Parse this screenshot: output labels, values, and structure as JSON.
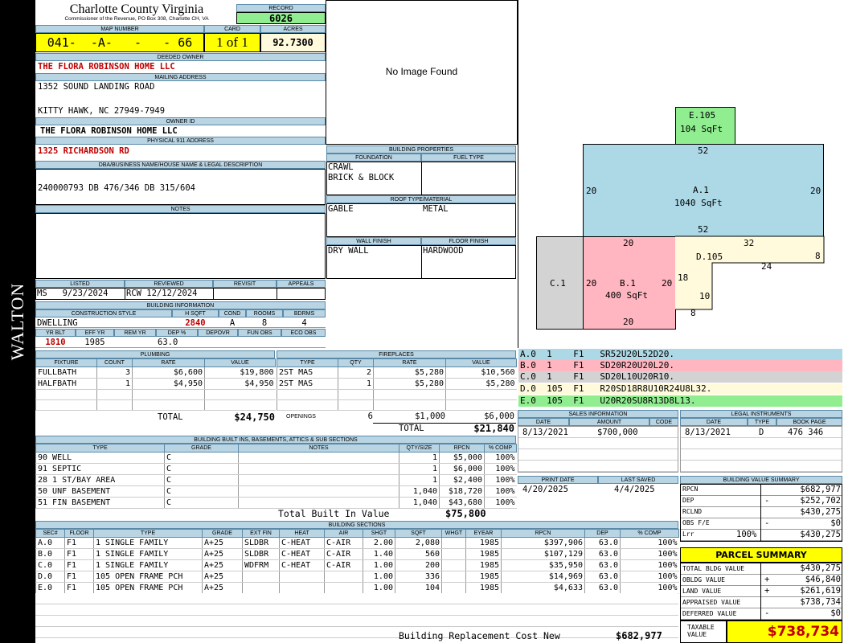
{
  "sidebar": {
    "name": "WALTON"
  },
  "header": {
    "county": "Charlotte County Virginia",
    "commissioner": "Commissioner of the Revenue, PO Box 308, Charlotte CH, VA",
    "record_label": "RECORD",
    "record": "6026",
    "map_label": "MAP NUMBER",
    "map_number": "041-  -A-   -   - 66",
    "card_label": "CARD",
    "card": "1 of 1",
    "acres_label": "ACRES",
    "acres": "92.7300"
  },
  "owner": {
    "deeded_label": "DEEDED OWNER",
    "deeded": "THE FLORA ROBINSON HOME LLC",
    "mailing_label": "MAILING ADDRESS",
    "addr1": "1352 SOUND LANDING ROAD",
    "addr2": "KITTY HAWK, NC 27949-7949",
    "owner_id_label": "OWNER ID",
    "owner_id": "THE FLORA ROBINSON HOME LLC",
    "physical_label": "PHYSICAL 911 ADDRESS",
    "physical": "1325 RICHARDSON RD",
    "dba_label": "DBA/BUSINESS NAME/HOUSE NAME & LEGAL DESCRIPTION",
    "legal": "240000793 DB 476/346 DB 315/604",
    "notes_label": "NOTES"
  },
  "review": {
    "listed_label": "LISTED",
    "listed": "MS   9/23/2024",
    "reviewed_label": "REVIEWED",
    "reviewed": "RCW 12/12/2024",
    "revisit_label": "REVISIT",
    "appeals_label": "APPEALS"
  },
  "building_info": {
    "title": "BUILDING INFORMATION",
    "style_label": "CONSTRUCTION STYLE",
    "style": "DWELLING",
    "hsqft_label": "H SQFT",
    "hsqft": "2840",
    "cond_label": "COND",
    "cond": "A",
    "rooms_label": "ROOMS",
    "rooms": "8",
    "bdrms_label": "BDRMS",
    "bdrms": "4",
    "yrblt_label": "YR BLT",
    "yrblt": "1810",
    "effyr_label": "EFF YR",
    "effyr": "1985",
    "remyr_label": "REM YR",
    "deppct_label": "DEP %",
    "deppct": "63.0",
    "depovr_label": "DEPOVR",
    "funobs_label": "FUN OBS",
    "ecoobs_label": "ECO OBS"
  },
  "plumbing": {
    "title": "PLUMBING",
    "headers": [
      "FIXTURE",
      "COUNT",
      "RATE",
      "VALUE"
    ],
    "rows": [
      [
        "FULLBATH",
        "3",
        "$6,600",
        "$19,800"
      ],
      [
        "HALFBATH",
        "1",
        "$4,950",
        "$4,950"
      ],
      [
        "",
        "",
        "",
        ""
      ],
      [
        "",
        "",
        "",
        ""
      ]
    ],
    "total_label": "TOTAL",
    "total": "$24,750"
  },
  "fireplaces": {
    "title": "FIREPLACES",
    "headers": [
      "TYPE",
      "QTY",
      "RATE",
      "VALUE"
    ],
    "rows": [
      [
        "2ST MAS",
        "2",
        "$5,280",
        "$10,560"
      ],
      [
        "2ST MAS",
        "1",
        "$5,280",
        "$5,280"
      ],
      [
        "",
        "",
        "",
        ""
      ],
      [
        "",
        "",
        "",
        ""
      ]
    ],
    "openings_label": "OPENINGS",
    "openings_qty": "6",
    "openings_rate": "$1,000",
    "openings_value": "$6,000",
    "total_label": "TOTAL",
    "total": "$21,840"
  },
  "photo": {
    "text": "No Image Found"
  },
  "building_props": {
    "title": "BUILDING PROPERTIES",
    "foundation_label": "FOUNDATION",
    "foundation1": "CRAWL",
    "foundation2": "BRICK & BLOCK",
    "fuel_label": "FUEL TYPE",
    "roof_label": "ROOF TYPE/MATERIAL",
    "roof_type": "GABLE",
    "roof_material": "METAL",
    "wall_label": "WALL FINISH",
    "wall": "DRY WALL",
    "floor_label": "FLOOR FINISH",
    "floor": "HARDWOOD"
  },
  "sketch": {
    "e_label": "E.105",
    "e_sqft": "104 SqFt",
    "a_label": "A.1",
    "a_sqft": "1040 SqFt",
    "b_label": "B.1",
    "b_sqft": "400 SqFt",
    "c_label": "C.1",
    "d_label": "D.105",
    "dims": {
      "e_bottom": "52",
      "a_left": "20",
      "a_right": "20",
      "a_bottom": "52",
      "b_top": "20",
      "b_left": "20",
      "b_right": "20",
      "b_bottom": "20",
      "d_top": "32",
      "d_right": "8",
      "d_mid": "24",
      "d_left": "18",
      "d_step": "10",
      "d_bot": "8"
    },
    "colors": {
      "a": "#add8e6",
      "b": "#ffb6c1",
      "c": "#d3d3d3",
      "d": "#fffadc",
      "e": "#90ee90"
    }
  },
  "segments": [
    {
      "text": "A.0  1    F1   SR52U20L52D20.",
      "color": "#add8e6"
    },
    {
      "text": "B.0  1    F1   SD20R20U20L20.",
      "color": "#ffb6c1"
    },
    {
      "text": "C.0  1    F1   SD20L10U20R10.",
      "color": "#d3d3d3"
    },
    {
      "text": "D.0  105  F1   R20SD18R8U10R24U8L32.",
      "color": "#fffadc"
    },
    {
      "text": "E.0  105  F1   U20R20SU8R13D8L13.",
      "color": "#90ee90"
    }
  ],
  "sales": {
    "title": "SALES INFORMATION",
    "headers": [
      "DATE",
      "AMOUNT",
      "CODE"
    ],
    "rows": [
      [
        "8/13/2021",
        "$700,000",
        ""
      ]
    ]
  },
  "legal_inst": {
    "title": "LEGAL INSTRUMENTS",
    "headers": [
      "DATE",
      "TYPE",
      "BOOK PAGE"
    ],
    "rows": [
      [
        "8/13/2021",
        "D",
        "476 346"
      ]
    ]
  },
  "dates": {
    "print_label": "PRINT DATE",
    "print": "4/20/2025",
    "saved_label": "LAST SAVED",
    "saved": "4/4/2025"
  },
  "builtins": {
    "title": "BUILDING BUILT INS, BASEMENTS, ATTICS & SUB SECTIONS",
    "headers": [
      "TYPE",
      "GRADE",
      "NOTES",
      "QTY/SIZE",
      "RPCN",
      "% COMP"
    ],
    "rows": [
      [
        "90 WELL",
        "C",
        "",
        "1",
        "$5,000",
        "100%"
      ],
      [
        "91 SEPTIC",
        "C",
        "",
        "1",
        "$6,000",
        "100%"
      ],
      [
        "28 1 ST/BAY AREA",
        "C",
        "",
        "1",
        "$2,400",
        "100%"
      ],
      [
        "50 UNF BASEMENT",
        "C",
        "",
        "1,040",
        "$18,720",
        "100%"
      ],
      [
        "51 FIN BASEMENT",
        "C",
        "",
        "1,040",
        "$43,680",
        "100%"
      ]
    ],
    "total_label": "Total Built In Value",
    "total": "$75,800"
  },
  "sections": {
    "title": "BUILDING SECTIONS",
    "headers": [
      "SEC#",
      "FLOOR",
      "TYPE",
      "GRADE",
      "EXT FIN",
      "HEAT",
      "AIR",
      "SHGT",
      "SQFT",
      "WHGT",
      "EYEAR",
      "RPCN",
      "DEP",
      "% COMP"
    ],
    "rows": [
      [
        "A.0",
        "F1",
        "1 SINGLE FAMILY",
        "A+25",
        "SLDBR",
        "C-HEAT",
        "C-AIR",
        "2.00",
        "2,080",
        "",
        "1985",
        "$397,906",
        "63.0",
        "100%"
      ],
      [
        "B.0",
        "F1",
        "1 SINGLE FAMILY",
        "A+25",
        "SLDBR",
        "C-HEAT",
        "C-AIR",
        "1.40",
        "560",
        "",
        "1985",
        "$107,129",
        "63.0",
        "100%"
      ],
      [
        "C.0",
        "F1",
        "1 SINGLE FAMILY",
        "A+25",
        "WDFRM",
        "C-HEAT",
        "C-AIR",
        "1.00",
        "200",
        "",
        "1985",
        "$35,950",
        "63.0",
        "100%"
      ],
      [
        "D.0",
        "F1",
        "105 OPEN FRAME PCH",
        "A+25",
        "",
        "",
        "",
        "1.00",
        "336",
        "",
        "1985",
        "$14,969",
        "63.0",
        "100%"
      ],
      [
        "E.0",
        "F1",
        "105 OPEN FRAME PCH",
        "A+25",
        "",
        "",
        "",
        "1.00",
        "104",
        "",
        "1985",
        "$4,633",
        "63.0",
        "100%"
      ]
    ],
    "replacement_label": "Building Replacement Cost New",
    "replacement": "$682,977"
  },
  "value_summary": {
    "title": "BUILDING VALUE SUMMARY",
    "rows": [
      {
        "label": "RPCN",
        "sign": "",
        "value": "$682,977"
      },
      {
        "label": "DEP",
        "sign": "-",
        "value": "$252,702"
      },
      {
        "label": "RCLND",
        "sign": "",
        "value": "$430,275"
      },
      {
        "label": "OBS F/E",
        "sign": "-",
        "value": "$0"
      },
      {
        "label": "Lrr",
        "pct": "100%",
        "sign": "",
        "value": "$430,275"
      }
    ]
  },
  "parcel": {
    "title": "PARCEL SUMMARY",
    "rows": [
      {
        "label": "TOTAL BLDG VALUE",
        "sign": "",
        "value": "$430,275"
      },
      {
        "label": "OBLDG VALUE",
        "sign": "+",
        "value": "$46,840"
      },
      {
        "label": "LAND VALUE",
        "sign": "+",
        "value": "$261,619"
      },
      {
        "label": "APPRAISED VALUE",
        "sign": "",
        "value": "$738,734"
      },
      {
        "label": "DEFERRED VALUE",
        "sign": "-",
        "value": "$0"
      }
    ],
    "taxable_label": "TAXABLE VALUE",
    "taxable": "$738,734"
  }
}
